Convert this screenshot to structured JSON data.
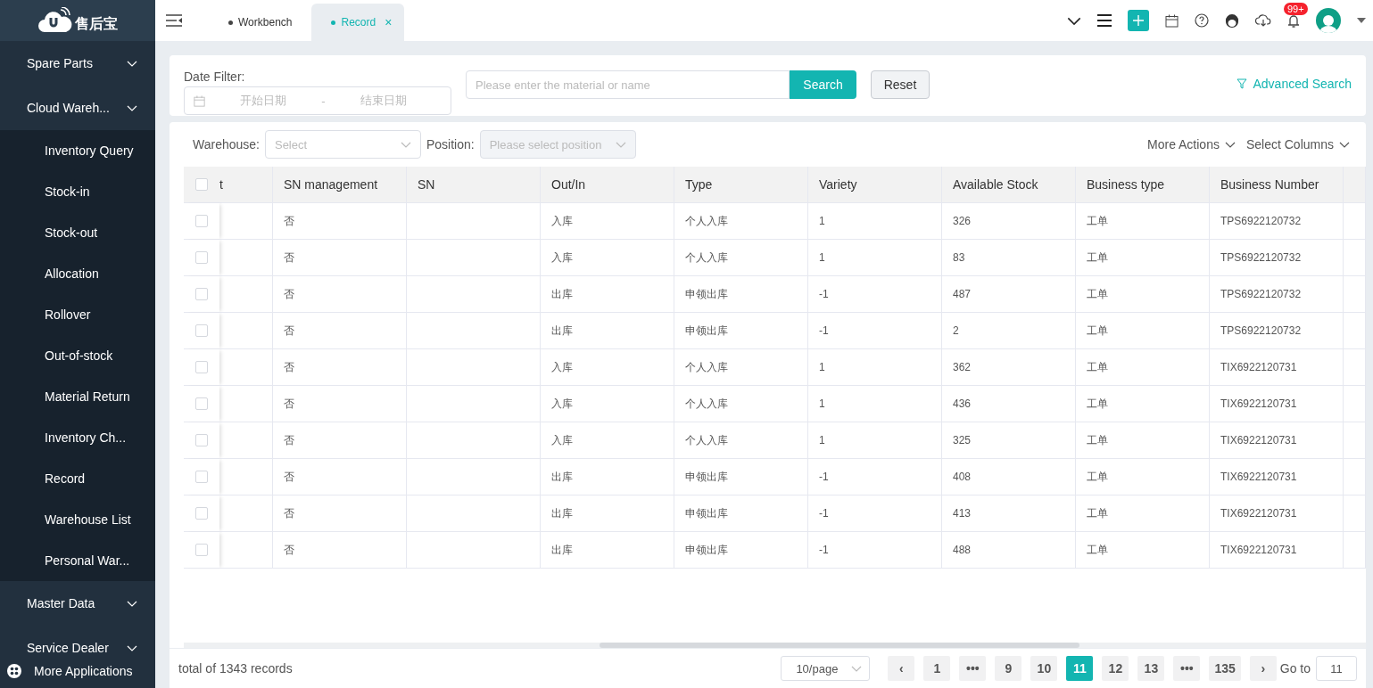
{
  "sidebar": {
    "logo_text": "售后宝",
    "items": [
      {
        "label": "Spare Parts",
        "selected": false
      },
      {
        "label": "Cloud Wareh...",
        "selected": false,
        "children": [
          {
            "label": "Inventory Query",
            "selected": false
          },
          {
            "label": "Stock-in",
            "selected": false
          },
          {
            "label": "Stock-out",
            "selected": false
          },
          {
            "label": "Allocation",
            "selected": false
          },
          {
            "label": "Rollover",
            "selected": false
          },
          {
            "label": "Out-of-stock",
            "selected": false
          },
          {
            "label": "Material Return",
            "selected": false
          },
          {
            "label": "Inventory Ch...",
            "selected": false
          },
          {
            "label": "Record",
            "selected": false
          },
          {
            "label": "Warehouse List",
            "selected": false
          },
          {
            "label": "Personal War...",
            "selected": false
          }
        ]
      },
      {
        "label": "Master Data",
        "selected": false
      },
      {
        "label": "Service Dealer",
        "selected": false
      }
    ],
    "footer": "More Applications"
  },
  "tabs": [
    {
      "label": "Workbench",
      "selected": false,
      "closable": false
    },
    {
      "label": "Record",
      "selected": true,
      "closable": true,
      "close": "×"
    }
  ],
  "header": {
    "badge": "99+"
  },
  "filters": {
    "date_label": "Date Filter:",
    "start_placeholder": "开始日期",
    "separator": "-",
    "end_placeholder": "结束日期",
    "search_placeholder": "Please enter the material or name",
    "search_button": "Search",
    "reset_button": "Reset",
    "advanced": "Advanced Search"
  },
  "toolbar": {
    "warehouse_label": "Warehouse:",
    "warehouse_placeholder": "Select",
    "position_label": "Position:",
    "position_placeholder": "Please select position",
    "position_disabled": true,
    "more_actions": "More Actions",
    "select_columns": "Select Columns"
  },
  "table": {
    "columns": [
      "t",
      "SN management",
      "SN",
      "Out/In",
      "Type",
      "Variety",
      "Available Stock",
      "Business type",
      "Business Number"
    ],
    "header_checked": false,
    "rows": [
      {
        "checked": false,
        "cells": [
          "",
          "否",
          "",
          "入库",
          "个人入库",
          "1",
          "326",
          "工单",
          "TPS6922120732"
        ]
      },
      {
        "checked": false,
        "cells": [
          "",
          "否",
          "",
          "入库",
          "个人入库",
          "1",
          "83",
          "工单",
          "TPS6922120732"
        ]
      },
      {
        "checked": false,
        "cells": [
          "",
          "否",
          "",
          "出库",
          "申领出库",
          "-1",
          "487",
          "工单",
          "TPS6922120732"
        ]
      },
      {
        "checked": false,
        "cells": [
          "",
          "否",
          "",
          "出库",
          "申领出库",
          "-1",
          "2",
          "工单",
          "TPS6922120732"
        ]
      },
      {
        "checked": false,
        "cells": [
          "",
          "否",
          "",
          "入库",
          "个人入库",
          "1",
          "362",
          "工单",
          "TIX6922120731"
        ]
      },
      {
        "checked": false,
        "cells": [
          "",
          "否",
          "",
          "入库",
          "个人入库",
          "1",
          "436",
          "工单",
          "TIX6922120731"
        ]
      },
      {
        "checked": false,
        "cells": [
          "",
          "否",
          "",
          "入库",
          "个人入库",
          "1",
          "325",
          "工单",
          "TIX6922120731"
        ]
      },
      {
        "checked": false,
        "cells": [
          "",
          "否",
          "",
          "出库",
          "申领出库",
          "-1",
          "408",
          "工单",
          "TIX6922120731"
        ]
      },
      {
        "checked": false,
        "cells": [
          "",
          "否",
          "",
          "出库",
          "申领出库",
          "-1",
          "413",
          "工单",
          "TIX6922120731"
        ]
      },
      {
        "checked": false,
        "cells": [
          "",
          "否",
          "",
          "出库",
          "申领出库",
          "-1",
          "488",
          "工单",
          "TIX6922120731"
        ]
      }
    ]
  },
  "pagination": {
    "total": "total of 1343 records",
    "page_size": "10/page",
    "prev": "‹",
    "next": "›",
    "pages": [
      {
        "label": "1",
        "selected": false
      },
      {
        "label": "•••",
        "selected": false
      },
      {
        "label": "9",
        "selected": false
      },
      {
        "label": "10",
        "selected": false
      },
      {
        "label": "11",
        "selected": true
      },
      {
        "label": "12",
        "selected": false
      },
      {
        "label": "13",
        "selected": false
      },
      {
        "label": "•••",
        "selected": false
      },
      {
        "label": "135",
        "selected": false
      }
    ],
    "goto_label": "Go to",
    "goto_value": "11"
  }
}
